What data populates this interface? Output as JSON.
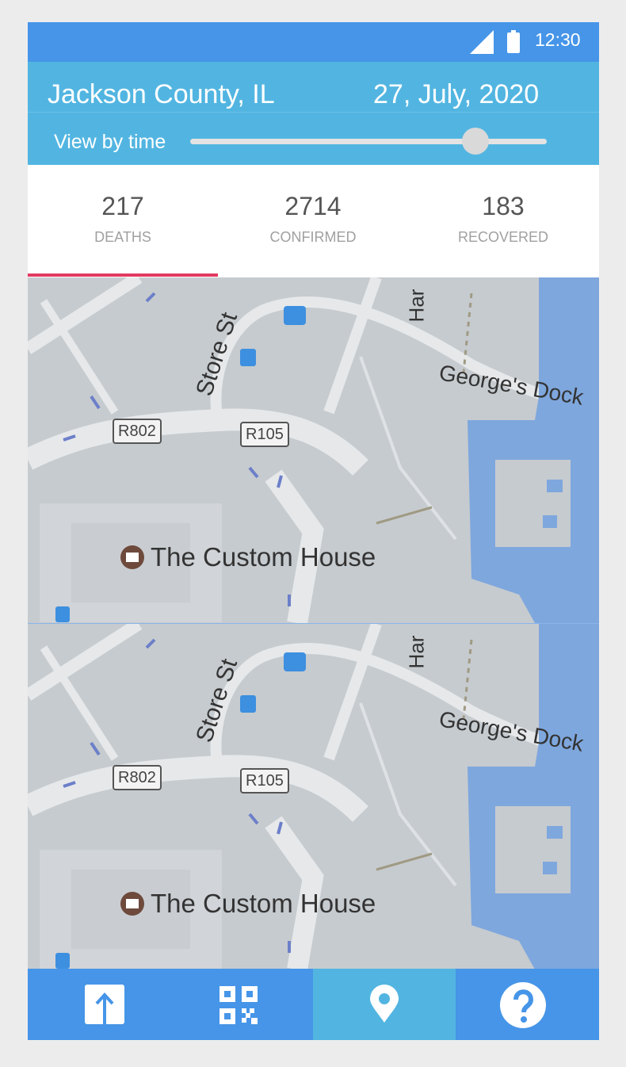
{
  "status_bar": {
    "time": "12:30"
  },
  "header": {
    "location": "Jackson County, IL",
    "date": "27, July, 2020",
    "time_slider_label": "View by time",
    "time_slider_value": 0.8
  },
  "stats": [
    {
      "value": "217",
      "label": "DEATHS",
      "selected": true
    },
    {
      "value": "2714",
      "label": "CONFIRMED",
      "selected": false
    },
    {
      "value": "183",
      "label": "RECOVERED",
      "selected": false
    }
  ],
  "map": {
    "street_label": "Store St",
    "dock_label": "George's Dock",
    "street_partial_label": "Har",
    "road_tag_1": "R802",
    "road_tag_2": "R105",
    "landmark": "The Custom House"
  },
  "bottom_nav": [
    {
      "icon": "upload-icon",
      "active": false
    },
    {
      "icon": "qr-code-icon",
      "active": false
    },
    {
      "icon": "location-pin-icon",
      "active": true
    },
    {
      "icon": "help-icon",
      "active": false
    }
  ],
  "colors": {
    "primary": "#4695e8",
    "header": "#52b5e1",
    "tab_indicator": "#e23a62",
    "water": "#7ea7dd"
  }
}
